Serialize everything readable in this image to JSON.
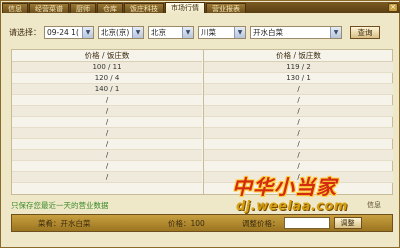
{
  "tabs": [
    {
      "label": "信息",
      "active": false
    },
    {
      "label": "经营菜谱",
      "active": false
    },
    {
      "label": "厨师",
      "active": false
    },
    {
      "label": "仓库",
      "active": false
    },
    {
      "label": "饭庄科技",
      "active": false
    },
    {
      "label": "市场行情",
      "active": true
    },
    {
      "label": "营业报表",
      "active": false
    }
  ],
  "close_glyph": "×",
  "filters": {
    "label": "请选择：",
    "date": "09-24 1(",
    "city1": "北京(京)",
    "city2": "北京",
    "cuisine": "川菜",
    "dish": "开水白菜",
    "query_label": "查询",
    "arrow_glyph": "▼"
  },
  "table": {
    "header_left": "价格 / 饭庄数",
    "header_right": "价格 / 饭庄数",
    "left_rows": [
      "100 / 11",
      "120 / 4",
      "140 / 1",
      "/",
      "/",
      "/",
      "/",
      "/",
      "/",
      "/",
      "/"
    ],
    "right_rows": [
      "119 / 2",
      "130 / 1",
      "/",
      "/",
      "/",
      "/",
      "/",
      "/",
      "/",
      "/",
      "/"
    ]
  },
  "note": "只保存您最近一天的营业数据",
  "note_right": "信息",
  "bottom": {
    "dish_label": "菜肴：开水白菜",
    "price_label": "价格：100",
    "adjust_label": "调整价格：",
    "adjust_button": "调整"
  },
  "watermark": {
    "title": "中华小当家",
    "url": "dj.weelaa.com"
  }
}
